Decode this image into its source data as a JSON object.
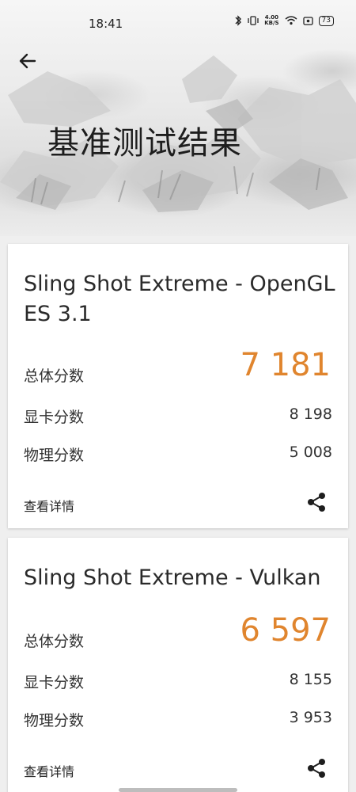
{
  "status_bar": {
    "time": "18:41",
    "speed_value": "4.00",
    "speed_unit": "KB/S",
    "battery": "73"
  },
  "header": {
    "title": "基准测试结果"
  },
  "results": [
    {
      "title": "Sling Shot Extreme - OpenGL ES 3.1",
      "overall_label": "总体分数",
      "overall_score": "7 181",
      "graphics_label": "显卡分数",
      "graphics_score": "8 198",
      "physics_label": "物理分数",
      "physics_score": "5 008",
      "details_label": "查看详情"
    },
    {
      "title": "Sling Shot Extreme - Vulkan",
      "overall_label": "总体分数",
      "overall_score": "6 597",
      "graphics_label": "显卡分数",
      "graphics_score": "8 155",
      "physics_label": "物理分数",
      "physics_score": "3 953",
      "details_label": "查看详情"
    }
  ],
  "colors": {
    "score_accent": "#e0852e",
    "background": "#efefef"
  }
}
